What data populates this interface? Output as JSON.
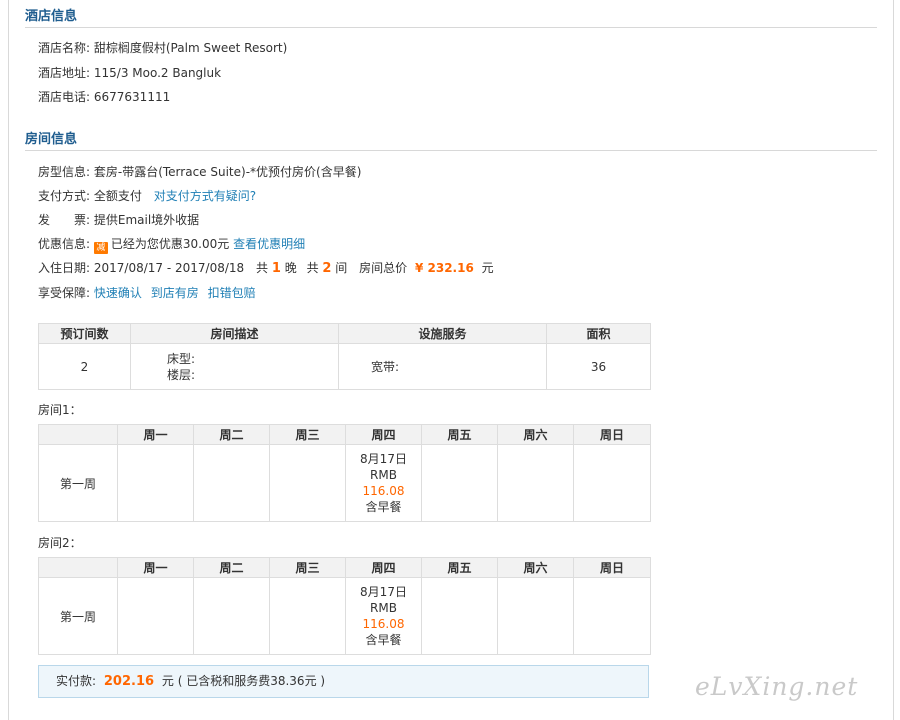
{
  "hotel": {
    "title": "酒店信息",
    "name_label": "酒店名称:",
    "name": "甜棕榈度假村(Palm Sweet Resort)",
    "address_label": "酒店地址:",
    "address": "115/3 Moo.2 Bangluk",
    "phone_label": "酒店电话:",
    "phone": "6677631111"
  },
  "room": {
    "title": "房间信息",
    "type_label": "房型信息:",
    "type": "套房-带露台(Terrace Suite)-*优预付房价(含早餐)",
    "pay_label": "支付方式:",
    "pay": "全额支付",
    "pay_link": "对支付方式有疑问?",
    "invoice_label": "发　　票:",
    "invoice": "提供Email境外收据",
    "discount_label": "优惠信息:",
    "discount_icon": "减",
    "discount_text": "已经为您优惠30.00元",
    "discount_link": "查看优惠明细",
    "date_label": "入住日期:",
    "dates": "2017/08/17 - 2017/08/18",
    "nights_pre": "共",
    "nights": "1",
    "nights_post": "晚",
    "rooms_pre": "共",
    "rooms": "2",
    "rooms_post": "间",
    "total_label": "房间总价",
    "total": "¥ 232.16",
    "total_unit": "元",
    "guarantee_label": "享受保障:",
    "guarantee": [
      "快速确认",
      "到店有房",
      "扣错包赔"
    ]
  },
  "summary_table": {
    "headers": [
      "预订间数",
      "房间描述",
      "设施服务",
      "面积"
    ],
    "rooms": "2",
    "bed_label": "床型:",
    "floor_label": "楼层:",
    "broadband_label": "宽带:",
    "area": "36"
  },
  "calendars": [
    {
      "label": "房间1：",
      "days": [
        "周一",
        "周二",
        "周三",
        "周四",
        "周五",
        "周六",
        "周日"
      ],
      "week": "第一周",
      "date": "8月17日",
      "currency": "RMB",
      "price": "116.08",
      "meal": "含早餐"
    },
    {
      "label": "房间2：",
      "days": [
        "周一",
        "周二",
        "周三",
        "周四",
        "周五",
        "周六",
        "周日"
      ],
      "week": "第一周",
      "date": "8月17日",
      "currency": "RMB",
      "price": "116.08",
      "meal": "含早餐"
    }
  ],
  "payment": {
    "label": "实付款:",
    "amount": "202.16",
    "unit": "元",
    "note": "( 已含税和服务费38.36元 )"
  },
  "watermark": "eLvXing.net"
}
